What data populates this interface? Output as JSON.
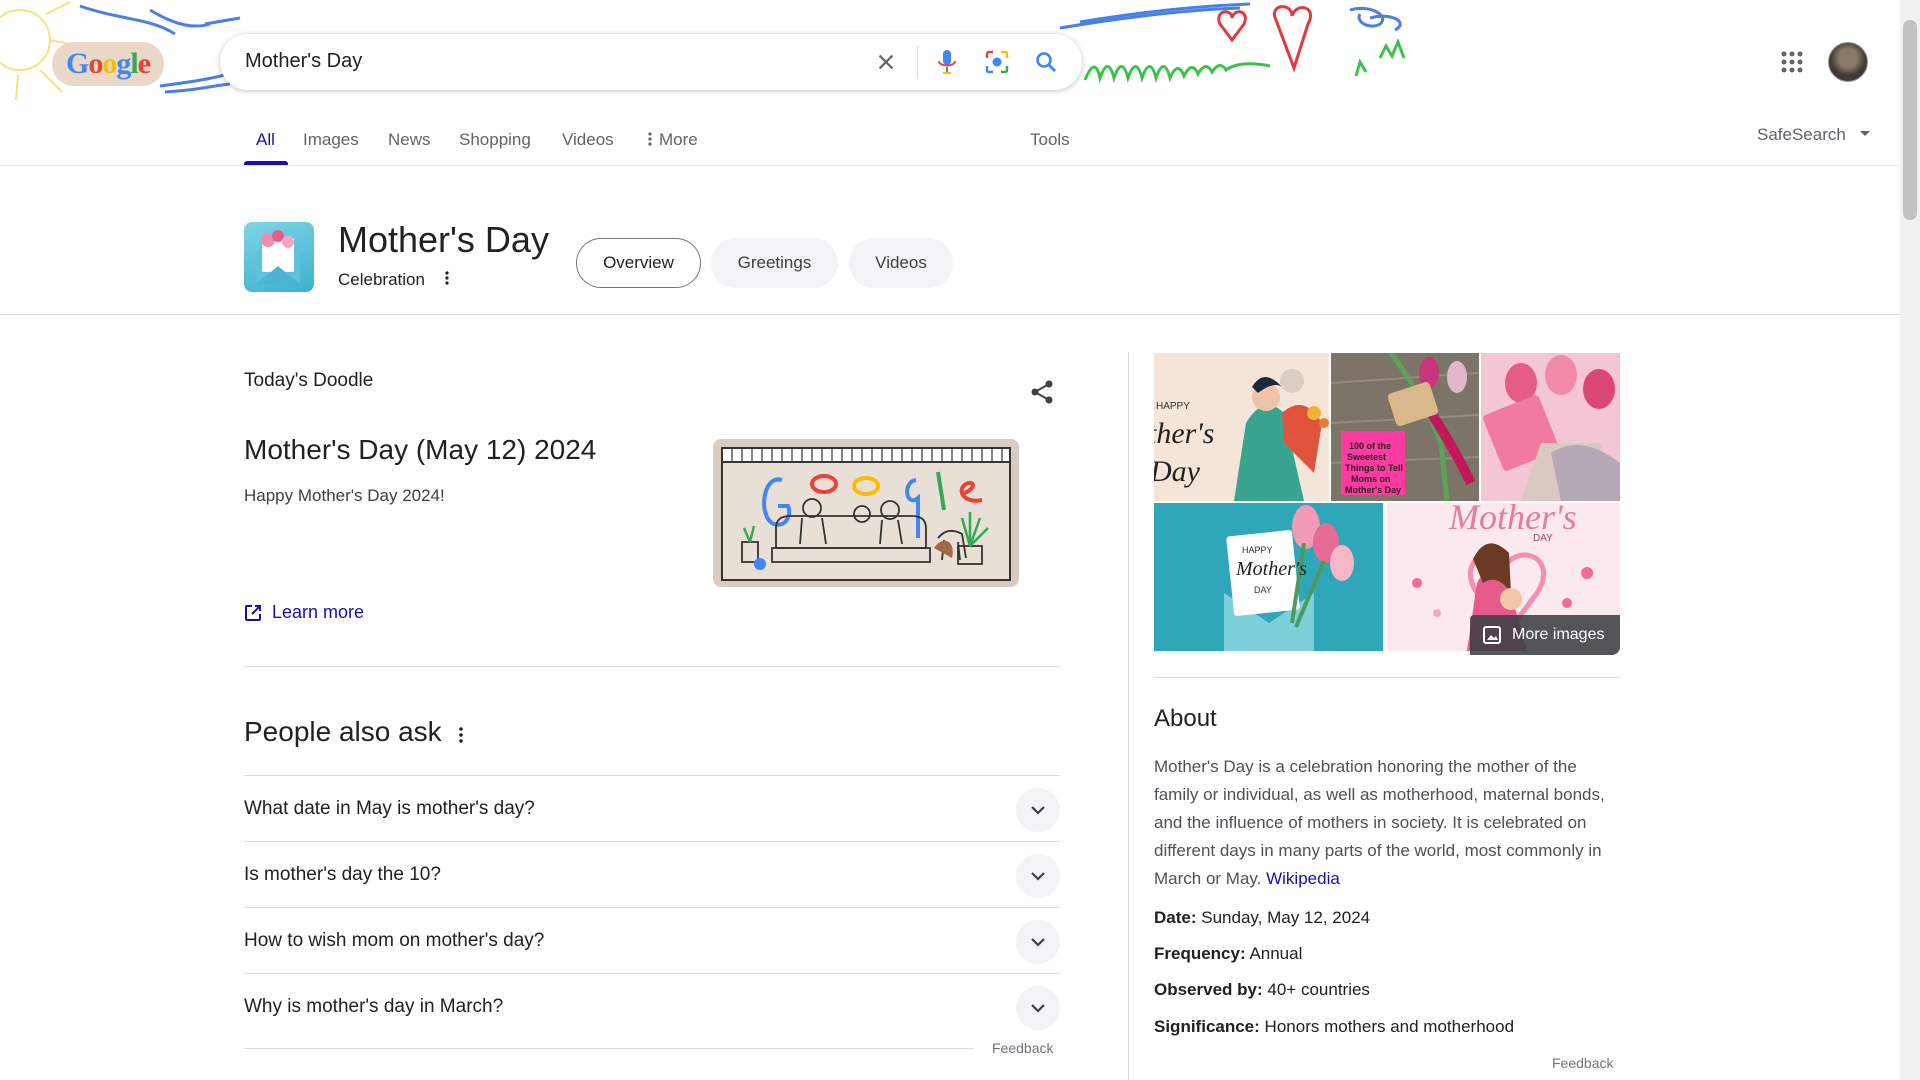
{
  "search": {
    "query": "Mother's Day",
    "logo_letters": [
      "G",
      "o",
      "o",
      "g",
      "l",
      "e"
    ]
  },
  "tabs": [
    {
      "label": "All",
      "active": true
    },
    {
      "label": "Images"
    },
    {
      "label": "News"
    },
    {
      "label": "Shopping"
    },
    {
      "label": "Videos"
    },
    {
      "label": "More"
    }
  ],
  "tools_label": "Tools",
  "safesearch_label": "SafeSearch",
  "entity": {
    "title": "Mother's Day",
    "subtitle": "Celebration",
    "chips": [
      "Overview",
      "Greetings",
      "Videos"
    ]
  },
  "doodle": {
    "section_label": "Today's Doodle",
    "title": "Mother's Day (May 12) 2024",
    "description": "Happy Mother's Day 2024!",
    "learn_more": "Learn more"
  },
  "paa": {
    "title": "People also ask",
    "questions": [
      "What date in May is mother's day?",
      "Is mother's day the 10?",
      "How to wish mom on mother's day?",
      "Why is mother's day in March?"
    ],
    "feedback": "Feedback"
  },
  "knowledge_panel": {
    "more_images": "More images",
    "image_texts": {
      "img1": "HAPPY\nMother's\nDay",
      "img2": "100 of the Sweetest Things to Tell Moms on Mother's Day",
      "img4": "HAPPY\nMother's\nDAY",
      "img5": "Mother's\nDAY"
    },
    "about_title": "About",
    "about_text": "Mother's Day is a celebration honoring the mother of the family or individual, as well as motherhood, maternal bonds, and the influence of mothers in society. It is celebrated on different days in many parts of the world, most commonly in March or May.",
    "about_source": "Wikipedia",
    "facts": [
      {
        "label": "Date:",
        "value": "Sunday, May 12, 2024"
      },
      {
        "label": "Frequency:",
        "value": "Annual"
      },
      {
        "label": "Observed by:",
        "value": "40+ countries"
      },
      {
        "label": "Significance:",
        "value": "Honors mothers and motherhood"
      }
    ],
    "feedback": "Feedback"
  },
  "colors": {
    "link": "#1a0dab",
    "google_blue": "#4285f4",
    "google_red": "#ea4335",
    "google_yellow": "#fbbc05",
    "google_green": "#34a853"
  }
}
